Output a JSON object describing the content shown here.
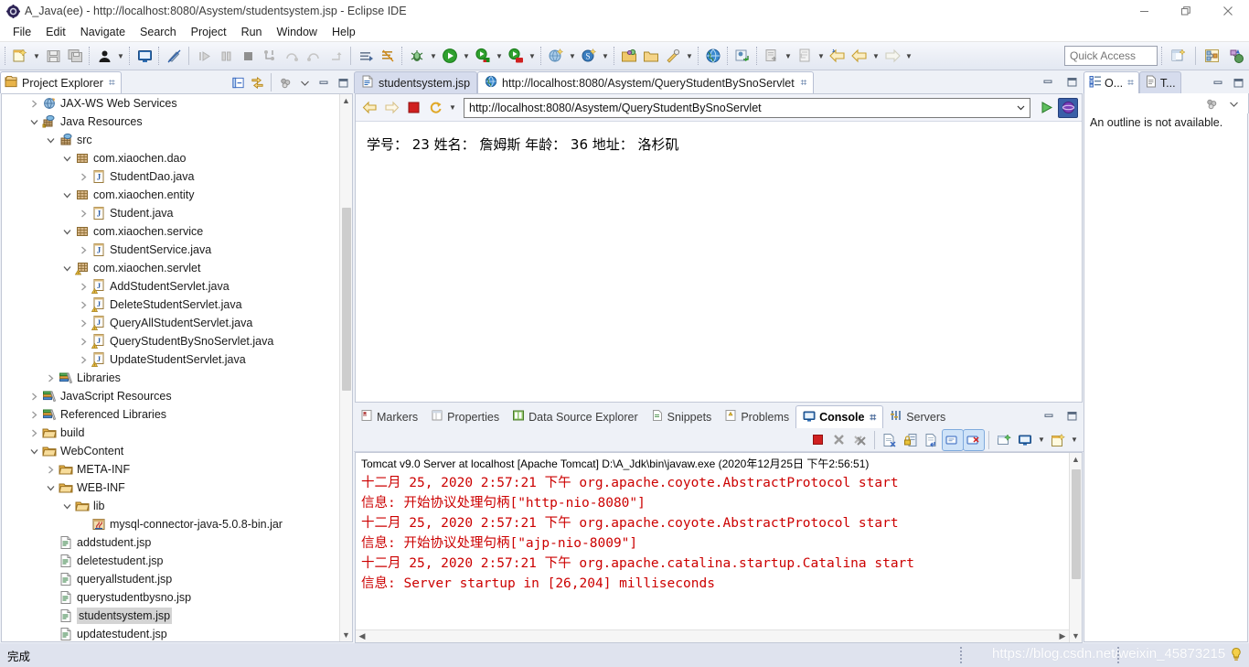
{
  "window": {
    "title": "A_Java(ee) - http://localhost:8080/Asystem/studentsystem.jsp - Eclipse IDE",
    "icon": "eclipse-icon",
    "minimize": "—",
    "maximize": "❐",
    "close": "✕"
  },
  "menubar": {
    "items": [
      "File",
      "Edit",
      "Navigate",
      "Search",
      "Project",
      "Run",
      "Window",
      "Help"
    ]
  },
  "toolbar": {
    "quick_access_placeholder": "Quick Access",
    "quick_access_value": "",
    "icons": [
      "new-wizard-icon",
      "save-icon",
      "save-all-icon",
      "print-icon",
      "open-type-icon",
      "terminal-icon",
      "toggle-mark-occurrences-icon",
      "resume-icon",
      "suspend-icon",
      "terminate-icon",
      "step-into-icon",
      "step-over-icon",
      "step-return-icon",
      "step-filters-icon",
      "next-annotation-icon",
      "skip-breakpoints-icon",
      "debug-icon",
      "run-icon",
      "run-as-server-icon",
      "run-external-icon",
      "new-java-project-icon",
      "new-spring-icon",
      "open-perspective-icon",
      "open-resource-icon",
      "search-icon",
      "web-browser-icon",
      "profile-icon",
      "external-tools-icon",
      "previous-edit-icon",
      "back-icon",
      "forward-icon"
    ],
    "perspective_icons": [
      "open-perspective-icon",
      "java-ee-perspective-icon",
      "java-perspective-icon"
    ]
  },
  "project_explorer": {
    "tab_label": "Project Explorer",
    "tab_icon": "project-explorer-icon",
    "tab_close": "⌗",
    "tools": [
      "collapse-all-icon",
      "link-with-editor-icon",
      "view-menu-icon",
      "minimize-icon",
      "maximize-icon"
    ],
    "tree": [
      {
        "indent": 1,
        "twisty": "collapsed",
        "icon": "web-services-icon",
        "label": "JAX-WS Web Services",
        "selected": false
      },
      {
        "indent": 1,
        "twisty": "expanded",
        "icon": "java-resources-icon",
        "label": "Java Resources",
        "selected": false
      },
      {
        "indent": 2,
        "twisty": "expanded",
        "icon": "source-folder-icon",
        "label": "src",
        "selected": false
      },
      {
        "indent": 3,
        "twisty": "expanded",
        "icon": "package-icon",
        "label": "com.xiaochen.dao",
        "selected": false
      },
      {
        "indent": 4,
        "twisty": "collapsed",
        "icon": "java-file-icon",
        "label": "StudentDao.java",
        "selected": false
      },
      {
        "indent": 3,
        "twisty": "expanded",
        "icon": "package-icon",
        "label": "com.xiaochen.entity",
        "selected": false
      },
      {
        "indent": 4,
        "twisty": "collapsed",
        "icon": "java-file-icon",
        "label": "Student.java",
        "selected": false
      },
      {
        "indent": 3,
        "twisty": "expanded",
        "icon": "package-icon",
        "label": "com.xiaochen.service",
        "selected": false
      },
      {
        "indent": 4,
        "twisty": "collapsed",
        "icon": "java-file-icon",
        "label": "StudentService.java",
        "selected": false
      },
      {
        "indent": 3,
        "twisty": "expanded",
        "icon": "package-warning-icon",
        "label": "com.xiaochen.servlet",
        "selected": false
      },
      {
        "indent": 4,
        "twisty": "collapsed",
        "icon": "java-file-warning-icon",
        "label": "AddStudentServlet.java",
        "selected": false
      },
      {
        "indent": 4,
        "twisty": "collapsed",
        "icon": "java-file-warning-icon",
        "label": "DeleteStudentServlet.java",
        "selected": false
      },
      {
        "indent": 4,
        "twisty": "collapsed",
        "icon": "java-file-warning-icon",
        "label": "QueryAllStudentServlet.java",
        "selected": false
      },
      {
        "indent": 4,
        "twisty": "collapsed",
        "icon": "java-file-warning-icon",
        "label": "QueryStudentBySnoServlet.java",
        "selected": false
      },
      {
        "indent": 4,
        "twisty": "collapsed",
        "icon": "java-file-warning-icon",
        "label": "UpdateStudentServlet.java",
        "selected": false
      },
      {
        "indent": 2,
        "twisty": "collapsed",
        "icon": "library-icon",
        "label": "Libraries",
        "selected": false
      },
      {
        "indent": 1,
        "twisty": "collapsed",
        "icon": "library-icon",
        "label": "JavaScript Resources",
        "selected": false
      },
      {
        "indent": 1,
        "twisty": "collapsed",
        "icon": "library-icon",
        "label": "Referenced Libraries",
        "selected": false
      },
      {
        "indent": 1,
        "twisty": "collapsed",
        "icon": "folder-icon",
        "label": "build",
        "selected": false
      },
      {
        "indent": 1,
        "twisty": "expanded",
        "icon": "folder-icon",
        "label": "WebContent",
        "selected": false
      },
      {
        "indent": 2,
        "twisty": "collapsed",
        "icon": "folder-icon",
        "label": "META-INF",
        "selected": false
      },
      {
        "indent": 2,
        "twisty": "expanded",
        "icon": "folder-icon",
        "label": "WEB-INF",
        "selected": false
      },
      {
        "indent": 3,
        "twisty": "expanded",
        "icon": "folder-icon",
        "label": "lib",
        "selected": false
      },
      {
        "indent": 4,
        "twisty": "none",
        "icon": "jar-icon",
        "label": "mysql-connector-java-5.0.8-bin.jar",
        "selected": false
      },
      {
        "indent": 2,
        "twisty": "none",
        "icon": "jsp-file-icon",
        "label": "addstudent.jsp",
        "selected": false
      },
      {
        "indent": 2,
        "twisty": "none",
        "icon": "jsp-file-icon",
        "label": "deletestudent.jsp",
        "selected": false
      },
      {
        "indent": 2,
        "twisty": "none",
        "icon": "jsp-file-icon",
        "label": "queryallstudent.jsp",
        "selected": false
      },
      {
        "indent": 2,
        "twisty": "none",
        "icon": "jsp-file-icon",
        "label": "querystudentbysno.jsp",
        "selected": false
      },
      {
        "indent": 2,
        "twisty": "none",
        "icon": "jsp-file-icon",
        "label": "studentsystem.jsp",
        "selected": true
      },
      {
        "indent": 2,
        "twisty": "none",
        "icon": "jsp-file-icon",
        "label": "updatestudent.jsp",
        "selected": false
      }
    ]
  },
  "editor": {
    "tabs": [
      {
        "label": "studentsystem.jsp",
        "icon": "jsp-file-icon",
        "active": false,
        "closeable": false
      },
      {
        "label": "http://localhost:8080/Asystem/QueryStudentBySnoServlet",
        "icon": "web-browser-icon",
        "active": true,
        "closeable": true,
        "close": "⌗"
      }
    ],
    "tools": [
      "minimize-icon",
      "maximize-icon"
    ],
    "browser": {
      "back_icon": "back-arrow-icon",
      "forward_icon": "forward-arrow-icon",
      "stop_icon": "stop-icon",
      "refresh_icon": "refresh-icon",
      "dropdown_icon": "chevron-down-icon",
      "url": "http://localhost:8080/Asystem/QueryStudentBySnoServlet",
      "go_icon": "go-play-icon",
      "open-external-icon": "open-external-browser-icon",
      "content": "学号： 23 姓名： 詹姆斯 年龄： 36 地址： 洛杉矶"
    }
  },
  "outline": {
    "tabs": [
      {
        "label": "O...",
        "icon": "outline-icon",
        "active": true,
        "close": "⌗"
      },
      {
        "label": "T...",
        "icon": "task-list-icon",
        "active": false
      }
    ],
    "tools": [
      "minimize-icon",
      "maximize-icon"
    ],
    "sub_tools": [
      "view-menu-icon",
      "chevron-down-icon"
    ],
    "message": "An outline is not available."
  },
  "console_panel": {
    "tabs": [
      {
        "label": "Markers",
        "icon": "markers-icon",
        "active": false
      },
      {
        "label": "Properties",
        "icon": "properties-icon",
        "active": false
      },
      {
        "label": "Data Source Explorer",
        "icon": "data-source-icon",
        "active": false
      },
      {
        "label": "Snippets",
        "icon": "snippets-icon",
        "active": false
      },
      {
        "label": "Problems",
        "icon": "problems-icon",
        "active": false
      },
      {
        "label": "Console",
        "icon": "console-icon",
        "active": true,
        "close": "⌗"
      },
      {
        "label": "Servers",
        "icon": "servers-icon",
        "active": false
      }
    ],
    "panel_tools": [
      "minimize-icon",
      "maximize-icon"
    ],
    "toolbar_icons": [
      "terminate-icon",
      "remove-launch-icon",
      "remove-all-launches-icon",
      "clear-console-icon",
      "scroll-lock-icon",
      "word-wrap-icon",
      "show-console-on-output-icon",
      "show-console-on-error-icon",
      "pin-console-icon",
      "display-selected-console-icon",
      "console-dropdown-icon",
      "open-console-icon",
      "open-console-dropdown-icon"
    ],
    "header": "Tomcat v9.0 Server at localhost [Apache Tomcat] D:\\A_Jdk\\bin\\javaw.exe (2020年12月25日 下午2:56:51)",
    "lines": [
      "十二月 25, 2020 2:57:21 下午 org.apache.coyote.AbstractProtocol start",
      "信息: 开始协议处理句柄[\"http-nio-8080\"]",
      "十二月 25, 2020 2:57:21 下午 org.apache.coyote.AbstractProtocol start",
      "信息: 开始协议处理句柄[\"ajp-nio-8009\"]",
      "十二月 25, 2020 2:57:21 下午 org.apache.catalina.startup.Catalina start",
      "信息: Server startup in [26,204] milliseconds"
    ],
    "text_color": "#cc0000"
  },
  "statusbar": {
    "message": "完成",
    "watermark": "https://blog.csdn.net/weixin_45873215",
    "bulb_icon": "tip-bulb-icon"
  },
  "colors": {
    "accent": "#cc0000",
    "tab_active": "#ffffff",
    "tab_inactive": "#d6dced",
    "chrome": "#eef1f7",
    "status_bg": "#dfe3ee"
  }
}
